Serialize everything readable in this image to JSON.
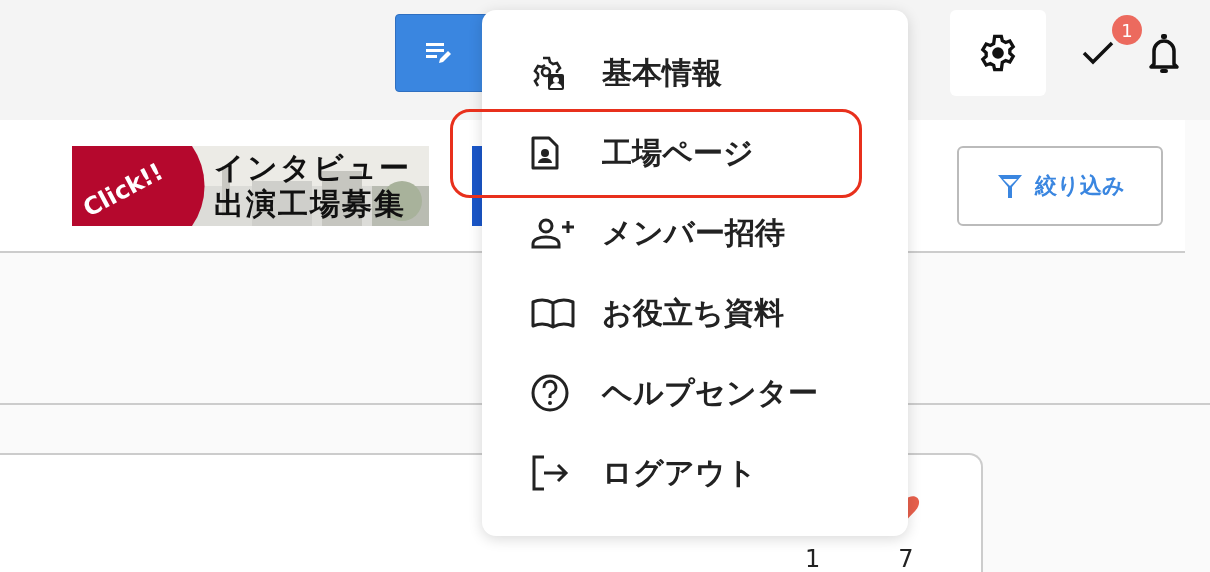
{
  "header": {
    "task_badge": "1"
  },
  "banner": {
    "badge": "Click!!",
    "lines": [
      "インタビュー",
      "出演工場募集"
    ]
  },
  "filter_button": {
    "label": "絞り込み"
  },
  "menu": {
    "items": [
      {
        "kind": "settings",
        "label": "基本情報",
        "selected": false
      },
      {
        "kind": "page",
        "label": "工場ページ",
        "selected": true
      },
      {
        "kind": "invite",
        "label": "メンバー招待",
        "selected": false
      },
      {
        "kind": "book",
        "label": "お役立ち資料",
        "selected": false
      },
      {
        "kind": "help",
        "label": "ヘルプセンター",
        "selected": false
      },
      {
        "kind": "logout",
        "label": "ログアウト",
        "selected": false
      }
    ]
  },
  "card": {
    "counts": [
      "1",
      "7"
    ]
  }
}
